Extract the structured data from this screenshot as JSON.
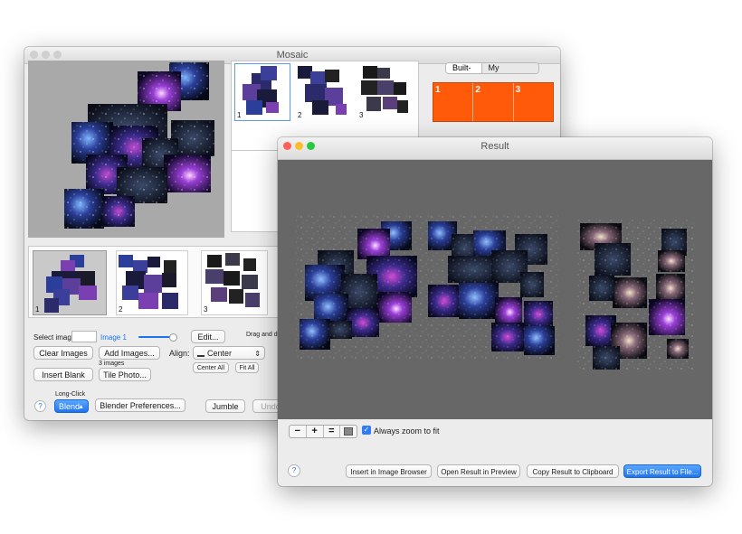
{
  "colors": {
    "accent_blue": "#1e74f0",
    "template_orange": "#ff5a0a",
    "close_red": "#ff5f57",
    "min_yellow": "#febc2e",
    "max_green": "#28c840"
  },
  "mosaic_window": {
    "title": "Mosaic",
    "browser_thumbs": [
      "1",
      "2",
      "3"
    ],
    "template_tabs": [
      "Built-In",
      "My Templates"
    ],
    "template_items": [
      "1",
      "2",
      "3"
    ],
    "image_strip": [
      "1",
      "2",
      "3"
    ],
    "controls": {
      "select_image_label": "Select image:",
      "image_name": "Image 1",
      "edit_button": "Edit...",
      "drag_hint": "Drag and drop",
      "clear_images": "Clear Images",
      "add_images": "Add Images...",
      "images_count": "3 images",
      "align_label": "Align:",
      "align_value": "Center",
      "insert_blank": "Insert Blank",
      "tile_photo": "Tile Photo...",
      "center_all": "Center All",
      "fit_all": "Fit All",
      "long_click": "Long-Click",
      "blend": "Blend",
      "blender_prefs": "Blender Preferences...",
      "jumble": "Jumble",
      "undo": "Undo",
      "help": "?"
    }
  },
  "result_window": {
    "title": "Result",
    "zoom_out": "−",
    "zoom_in": "+",
    "zoom_actual": "=",
    "always_zoom_label": "Always zoom to fit",
    "always_zoom_checked": true,
    "help": "?",
    "insert_browser": "Insert in Image Browser",
    "open_preview": "Open Result in Preview",
    "copy_clipboard": "Copy Result to Clipboard",
    "export_file": "Export Result to File..."
  }
}
